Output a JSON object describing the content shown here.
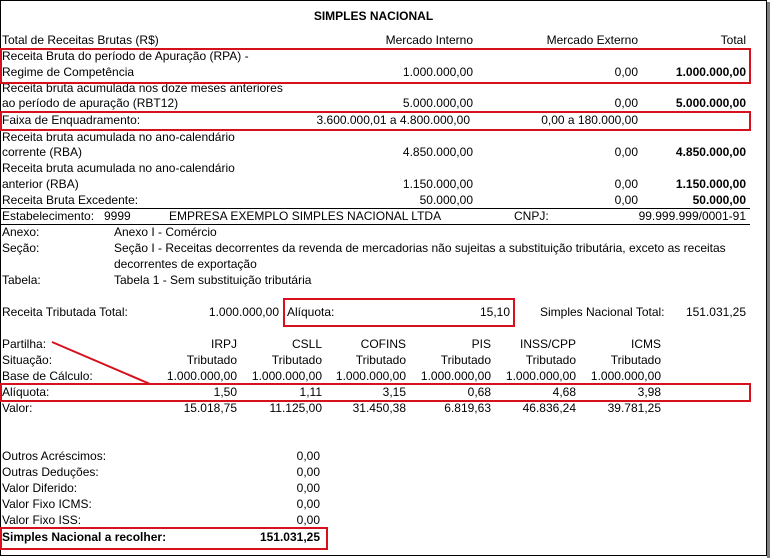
{
  "title": "SIMPLES NACIONAL",
  "header": {
    "label": "Total de Receitas Brutas (R$)",
    "col_interno": "Mercado Interno",
    "col_externo": "Mercado Externo",
    "col_total": "Total"
  },
  "rows": {
    "rpa": {
      "l1": "Receita Bruta do período de Apuração (RPA) -",
      "l2": "Regime de Competência",
      "interno": "1.000.000,00",
      "externo": "0,00",
      "total": "1.000.000,00"
    },
    "rbt12": {
      "l1": "Receita bruta acumulada nos doze meses anteriores",
      "l2": "ao período de apuração (RBT12)",
      "interno": "5.000.000,00",
      "externo": "0,00",
      "total": "5.000.000,00"
    },
    "faixa": {
      "l1": "Faixa de Enquadramento:",
      "interno": "3.600.000,01 a 4.800.000,00",
      "externo": "0,00 a 180.000,00"
    },
    "rba": {
      "l1": "Receita bruta acumulada no ano-calendário",
      "l2": "corrente (RBA)",
      "interno": "4.850.000,00",
      "externo": "0,00",
      "total": "4.850.000,00"
    },
    "rbaa": {
      "l1": "Receita bruta acumulada no ano-calendário",
      "l2": "anterior (RBA)",
      "interno": "1.150.000,00",
      "externo": "0,00",
      "total": "1.150.000,00"
    },
    "excedente": {
      "l1": "Receita Bruta Excedente:",
      "interno": "50.000,00",
      "externo": "0,00",
      "total": "50.000,00"
    }
  },
  "estab": {
    "label": "Estabelecimento:",
    "code": "9999",
    "name": "EMPRESA EXEMPLO SIMPLES NACIONAL LTDA",
    "cnpj_label": "CNPJ:",
    "cnpj": "99.999.999/0001-91"
  },
  "anexo": {
    "label": "Anexo:",
    "value": "Anexo I - Comércio"
  },
  "secao": {
    "label": "Seção:",
    "l1": "Seção I - Receitas decorrentes da revenda de mercadorias não sujeitas a substituição tributária, exceto as receitas",
    "l2": "decorrentes de exportação"
  },
  "tabela": {
    "label": "Tabela:",
    "value": "Tabela 1 - Sem substituição tributária"
  },
  "tributada": {
    "label": "Receita Tributada Total:",
    "value": "1.000.000,00",
    "aliq_label": "Alíquota:",
    "aliq_value": "15,10",
    "sn_label": "Simples Nacional Total:",
    "sn_value": "151.031,25"
  },
  "partilha": {
    "labels": {
      "partilha": "Partilha:",
      "situacao": "Situação:",
      "base": "Base de Cálculo:",
      "aliquota": "Alíquota:",
      "valor": "Valor:"
    },
    "cols": [
      {
        "name": "IRPJ",
        "situacao": "Tributado",
        "base": "1.000.000,00",
        "aliquota": "1,50",
        "valor": "15.018,75"
      },
      {
        "name": "CSLL",
        "situacao": "Tributado",
        "base": "1.000.000,00",
        "aliquota": "1,11",
        "valor": "11.125,00"
      },
      {
        "name": "COFINS",
        "situacao": "Tributado",
        "base": "1.000.000,00",
        "aliquota": "3,15",
        "valor": "31.450,38"
      },
      {
        "name": "PIS",
        "situacao": "Tributado",
        "base": "1.000.000,00",
        "aliquota": "0,68",
        "valor": "6.819,63"
      },
      {
        "name": "INSS/CPP",
        "situacao": "Tributado",
        "base": "1.000.000,00",
        "aliquota": "4,68",
        "valor": "46.836,24"
      },
      {
        "name": "ICMS",
        "situacao": "Tributado",
        "base": "1.000.000,00",
        "aliquota": "3,98",
        "valor": "39.781,25"
      }
    ]
  },
  "outros": [
    {
      "label": "Outros Acréscimos:",
      "value": "0,00"
    },
    {
      "label": "Outras Deduções:",
      "value": "0,00"
    },
    {
      "label": "Valor Diferido:",
      "value": "0,00"
    },
    {
      "label": "Valor Fixo ICMS:",
      "value": "0,00"
    },
    {
      "label": "Valor Fixo ISS:",
      "value": "0,00"
    }
  ],
  "recolher": {
    "label": "Simples Nacional a recolher:",
    "value": "151.031,25"
  },
  "colors": {
    "highlight": "#d6101c"
  }
}
